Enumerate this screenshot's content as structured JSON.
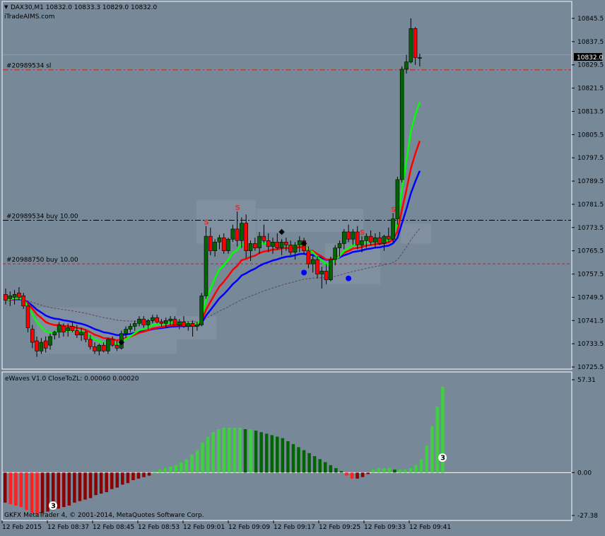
{
  "header": {
    "symbol_line": "DAX30,M1  10832.0 10833.3 10829.0 10832.0",
    "watermark": "iTradeAIMS.com"
  },
  "price_axis": {
    "ticks": [
      "10845.5",
      "10837.5",
      "10829.5",
      "10821.5",
      "10813.5",
      "10805.5",
      "10797.5",
      "10789.5",
      "10781.5",
      "10773.5",
      "10765.5",
      "10757.5",
      "10749.5",
      "10741.5",
      "10733.5",
      "10725.5"
    ],
    "current_price": "10832.0"
  },
  "order_lines": [
    {
      "label": "#20989534 sl",
      "price": 10827.8,
      "color": "#c81e1e",
      "style": "dashdot"
    },
    {
      "label": "#20989534 buy 10.00",
      "price": 10776.0,
      "color": "#000000",
      "style": "dashdot"
    },
    {
      "label": "#20988750 buy 10.00",
      "price": 10761.0,
      "color": "#c81e1e",
      "style": "dashed"
    }
  ],
  "indicator": {
    "title": "eWaves V1.0 CloseToZL: 0.00060 0.00020",
    "ticks": [
      "57.31",
      "0.00",
      "-27.38"
    ],
    "markers": [
      "3",
      "3"
    ]
  },
  "time_axis": {
    "labels": [
      "12 Feb 2015",
      "12 Feb 08:37",
      "12 Feb 08:45",
      "12 Feb 08:53",
      "12 Feb 09:01",
      "12 Feb 09:09",
      "12 Feb 09:17",
      "12 Feb 09:25",
      "12 Feb 09:33",
      "12 Feb 09:41"
    ]
  },
  "footer": {
    "copyright": "GKFX MetaTrader 4, © 2001-2014, MetaQuotes Software Corp."
  },
  "colors": {
    "background": "#778899",
    "bull": "#006400",
    "bear": "#ff0000",
    "ma_fast": "#00ff00",
    "ma_mid": "#ff0000",
    "ma_slow": "#0000ff",
    "zone": "#8a97a5"
  },
  "chart_data": {
    "type": "candlestick",
    "ylim": [
      10725.5,
      10849.5
    ],
    "candles_ohlc": [
      [
        10750.5,
        10752.5,
        10747.0,
        10748.5
      ],
      [
        10749.0,
        10751.5,
        10746.5,
        10750.0
      ],
      [
        10749.5,
        10752.0,
        10747.0,
        10750.5
      ],
      [
        10751.0,
        10753.0,
        10748.5,
        10749.5
      ],
      [
        10750.0,
        10751.0,
        10745.5,
        10746.5
      ],
      [
        10746.5,
        10747.5,
        10737.5,
        10739.0
      ],
      [
        10738.5,
        10740.0,
        10732.0,
        10734.0
      ],
      [
        10734.5,
        10736.0,
        10729.0,
        10731.0
      ],
      [
        10731.0,
        10735.5,
        10730.0,
        10734.0
      ],
      [
        10734.5,
        10736.0,
        10730.5,
        10732.0
      ],
      [
        10733.0,
        10737.0,
        10731.5,
        10736.0
      ],
      [
        10736.5,
        10738.0,
        10735.0,
        10737.5
      ],
      [
        10737.5,
        10741.0,
        10735.5,
        10740.0
      ],
      [
        10739.5,
        10740.5,
        10736.0,
        10737.5
      ],
      [
        10738.0,
        10740.5,
        10736.0,
        10739.0
      ],
      [
        10739.5,
        10741.0,
        10737.5,
        10738.0
      ],
      [
        10738.0,
        10740.0,
        10735.5,
        10736.5
      ],
      [
        10736.5,
        10739.0,
        10734.5,
        10737.5
      ],
      [
        10737.5,
        10738.5,
        10734.0,
        10735.0
      ],
      [
        10735.0,
        10736.5,
        10731.5,
        10732.5
      ],
      [
        10732.5,
        10734.0,
        10730.0,
        10731.0
      ],
      [
        10731.0,
        10733.5,
        10729.5,
        10733.0
      ],
      [
        10733.0,
        10734.0,
        10730.5,
        10731.0
      ],
      [
        10731.0,
        10735.5,
        10730.0,
        10735.0
      ],
      [
        10735.0,
        10736.0,
        10732.5,
        10733.0
      ],
      [
        10733.0,
        10734.5,
        10731.0,
        10732.0
      ],
      [
        10732.0,
        10738.0,
        10731.5,
        10737.0
      ],
      [
        10737.0,
        10739.5,
        10735.5,
        10738.5
      ],
      [
        10738.5,
        10740.5,
        10737.5,
        10739.5
      ],
      [
        10739.5,
        10741.5,
        10738.0,
        10740.5
      ],
      [
        10740.5,
        10743.0,
        10739.5,
        10742.0
      ],
      [
        10742.0,
        10743.0,
        10739.0,
        10740.0
      ],
      [
        10740.0,
        10742.0,
        10738.5,
        10741.5
      ],
      [
        10741.5,
        10743.5,
        10740.5,
        10742.5
      ],
      [
        10742.5,
        10743.5,
        10740.5,
        10741.0
      ],
      [
        10741.0,
        10742.0,
        10739.5,
        10740.5
      ],
      [
        10740.5,
        10742.5,
        10739.0,
        10741.5
      ],
      [
        10741.5,
        10743.0,
        10740.0,
        10742.0
      ],
      [
        10742.0,
        10743.0,
        10739.5,
        10740.0
      ],
      [
        10740.0,
        10742.0,
        10738.5,
        10741.0
      ],
      [
        10741.0,
        10743.0,
        10739.0,
        10739.5
      ],
      [
        10739.5,
        10741.0,
        10738.0,
        10740.5
      ],
      [
        10740.5,
        10741.5,
        10736.0,
        10739.5
      ],
      [
        10739.5,
        10741.0,
        10738.0,
        10740.0
      ],
      [
        10740.0,
        10751.0,
        10739.5,
        10750.0
      ],
      [
        10750.0,
        10774.0,
        10749.0,
        10770.5
      ],
      [
        10770.5,
        10773.5,
        10764.0,
        10765.5
      ],
      [
        10765.5,
        10769.5,
        10763.5,
        10768.5
      ],
      [
        10768.5,
        10771.0,
        10766.0,
        10770.0
      ],
      [
        10770.0,
        10771.5,
        10764.5,
        10765.5
      ],
      [
        10765.5,
        10770.0,
        10764.5,
        10769.5
      ],
      [
        10769.5,
        10774.5,
        10768.5,
        10773.0
      ],
      [
        10773.0,
        10779.0,
        10767.0,
        10769.0
      ],
      [
        10769.0,
        10777.0,
        10766.5,
        10775.0
      ],
      [
        10775.0,
        10778.0,
        10763.0,
        10765.5
      ],
      [
        10765.5,
        10769.0,
        10762.0,
        10768.0
      ],
      [
        10768.0,
        10770.0,
        10765.5,
        10766.5
      ],
      [
        10766.5,
        10772.0,
        10764.5,
        10770.5
      ],
      [
        10770.5,
        10774.5,
        10768.0,
        10769.0
      ],
      [
        10769.0,
        10771.5,
        10765.0,
        10767.0
      ],
      [
        10767.0,
        10770.0,
        10764.5,
        10768.5
      ],
      [
        10768.5,
        10771.5,
        10766.0,
        10766.5
      ],
      [
        10766.5,
        10769.5,
        10764.0,
        10768.5
      ],
      [
        10768.5,
        10770.0,
        10765.5,
        10767.5
      ],
      [
        10767.5,
        10769.0,
        10764.0,
        10765.0
      ],
      [
        10765.0,
        10768.5,
        10762.5,
        10767.5
      ],
      [
        10767.5,
        10770.5,
        10765.0,
        10769.0
      ],
      [
        10769.0,
        10770.0,
        10764.5,
        10765.5
      ],
      [
        10765.5,
        10767.0,
        10759.5,
        10761.0
      ],
      [
        10761.0,
        10764.0,
        10758.0,
        10762.5
      ],
      [
        10762.5,
        10763.5,
        10756.0,
        10757.5
      ],
      [
        10757.5,
        10760.0,
        10752.5,
        10758.5
      ],
      [
        10758.5,
        10761.0,
        10754.0,
        10755.5
      ],
      [
        10755.5,
        10763.5,
        10755.0,
        10762.5
      ],
      [
        10762.5,
        10767.5,
        10760.5,
        10766.5
      ],
      [
        10766.5,
        10769.0,
        10763.5,
        10768.0
      ],
      [
        10768.0,
        10773.0,
        10766.0,
        10772.0
      ],
      [
        10772.0,
        10774.5,
        10768.5,
        10769.5
      ],
      [
        10769.5,
        10773.0,
        10767.5,
        10772.0
      ],
      [
        10772.0,
        10774.0,
        10766.0,
        10767.5
      ],
      [
        10767.5,
        10770.5,
        10765.0,
        10769.0
      ],
      [
        10769.0,
        10771.5,
        10766.5,
        10770.5
      ],
      [
        10770.5,
        10772.5,
        10767.5,
        10768.5
      ],
      [
        10768.5,
        10771.5,
        10766.5,
        10770.0
      ],
      [
        10770.0,
        10772.0,
        10767.5,
        10768.0
      ],
      [
        10768.0,
        10771.0,
        10765.5,
        10770.5
      ],
      [
        10770.5,
        10773.5,
        10768.5,
        10769.5
      ],
      [
        10769.5,
        10778.5,
        10768.5,
        10776.5
      ],
      [
        10776.5,
        10791.0,
        10774.5,
        10790.0
      ],
      [
        10790.0,
        10829.0,
        10789.0,
        10828.0
      ],
      [
        10828.0,
        10833.0,
        10826.5,
        10830.5
      ],
      [
        10830.5,
        10845.5,
        10830.0,
        10842.0
      ],
      [
        10842.0,
        10842.5,
        10829.5,
        10832.0
      ],
      [
        10832.0,
        10833.3,
        10829.0,
        10832.0
      ]
    ],
    "ewaves_histogram": [
      -20.0,
      -21.0,
      -22.0,
      -23.0,
      -25.0,
      -27.0,
      -28.0,
      -27.0,
      -26.0,
      -25.0,
      -24.0,
      -23.0,
      -22.0,
      -20.0,
      -19.0,
      -18.0,
      -17.0,
      -15.0,
      -14.0,
      -13.0,
      -11.0,
      -10.0,
      -8.0,
      -7.0,
      -5.0,
      -4.0,
      -3.0,
      -2.0,
      1.0,
      2.0,
      3.0,
      4.0,
      5.0,
      7.0,
      9.0,
      12.0,
      15.0,
      20.0,
      24.0,
      27.0,
      29.0,
      30.0,
      30.0,
      30.0,
      30.0,
      29.0,
      29.0,
      28.0,
      27.0,
      26.0,
      25.0,
      24.0,
      23.0,
      21.0,
      19.0,
      17.0,
      15.0,
      13.0,
      11.0,
      9.0,
      7.0,
      5.0,
      3.0,
      1.0,
      -2.0,
      -4.0,
      -4.0,
      -3.0,
      -1.0,
      2.0,
      3.0,
      3.0,
      3.0,
      2.0,
      2.0,
      2.0,
      3.0,
      5.0,
      9.0,
      18.0,
      31.0,
      44.0,
      57.31
    ],
    "y_range_indicator": [
      -30.5,
      62.0
    ]
  }
}
